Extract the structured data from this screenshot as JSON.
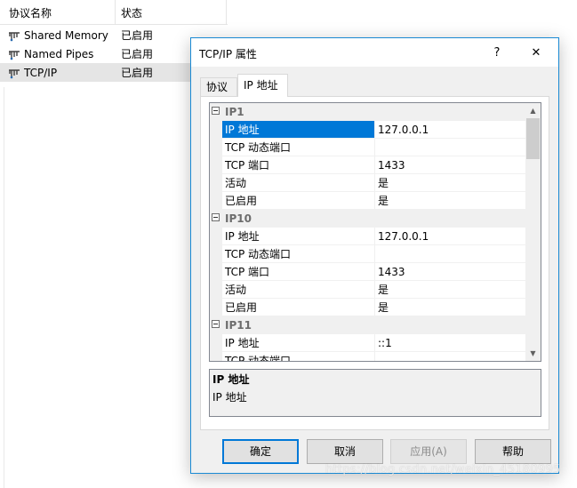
{
  "protocol_list": {
    "headers": {
      "name": "协议名称",
      "status": "状态"
    },
    "rows": [
      {
        "name": "Shared Memory",
        "status": "已启用",
        "icon": "protocol-icon"
      },
      {
        "name": "Named Pipes",
        "status": "已启用",
        "icon": "protocol-icon"
      },
      {
        "name": "TCP/IP",
        "status": "已启用",
        "icon": "protocol-icon"
      }
    ]
  },
  "dialog": {
    "title": "TCP/IP 属性",
    "help_label": "?",
    "close_label": "✕",
    "tabs": [
      {
        "label": "协议"
      },
      {
        "label": "IP 地址"
      }
    ],
    "grid": {
      "rows": [
        {
          "type": "category",
          "name": "IP1",
          "value": ""
        },
        {
          "type": "prop",
          "name": "IP 地址",
          "value": "127.0.0.1"
        },
        {
          "type": "prop",
          "name": "TCP 动态端口",
          "value": ""
        },
        {
          "type": "prop",
          "name": "TCP 端口",
          "value": "1433"
        },
        {
          "type": "prop",
          "name": "活动",
          "value": "是"
        },
        {
          "type": "prop",
          "name": "已启用",
          "value": "是"
        },
        {
          "type": "category",
          "name": "IP10",
          "value": ""
        },
        {
          "type": "prop",
          "name": "IP 地址",
          "value": "127.0.0.1"
        },
        {
          "type": "prop",
          "name": "TCP 动态端口",
          "value": ""
        },
        {
          "type": "prop",
          "name": "TCP 端口",
          "value": "1433"
        },
        {
          "type": "prop",
          "name": "活动",
          "value": "是"
        },
        {
          "type": "prop",
          "name": "已启用",
          "value": "是"
        },
        {
          "type": "category",
          "name": "IP11",
          "value": ""
        },
        {
          "type": "prop",
          "name": "IP 地址",
          "value": "::1"
        },
        {
          "type": "prop",
          "name": "TCP 动态端口",
          "value": ""
        }
      ],
      "scroll_up": "▲",
      "scroll_down": "▼"
    },
    "description": {
      "title": "IP 地址",
      "text": "IP 地址"
    },
    "buttons": {
      "ok": "确定",
      "cancel": "取消",
      "apply": "应用(A)",
      "help": "帮助"
    }
  },
  "watermark": "https://blog.csdn.net/weixin_45180995",
  "colors": {
    "selection": "#0078d7",
    "dialog_border": "#1a8ad4",
    "dialog_bg": "#f0f0f0"
  }
}
